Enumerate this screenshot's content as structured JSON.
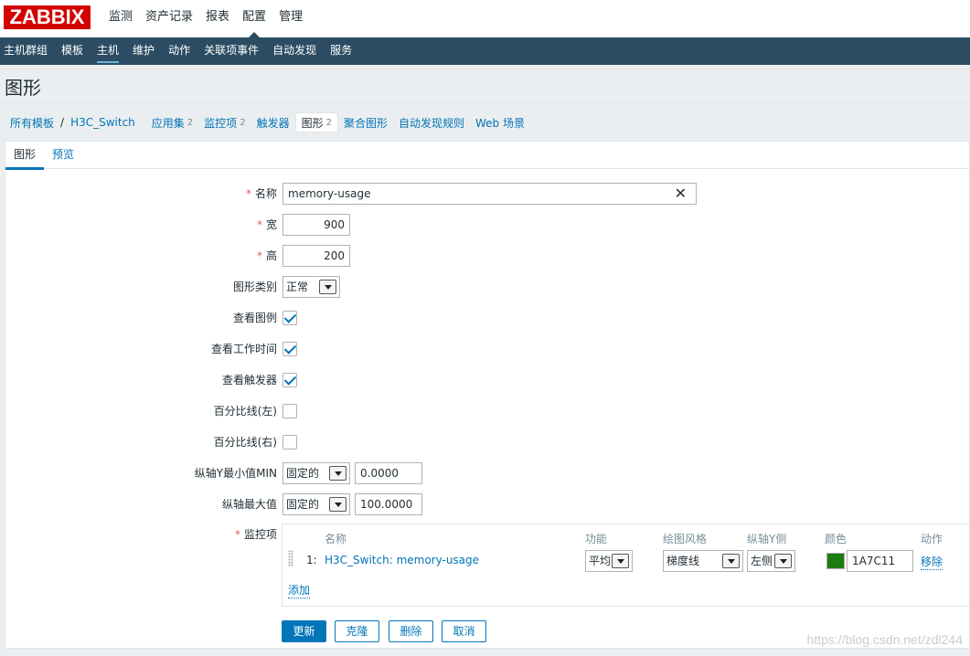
{
  "logo": "ZABBIX",
  "main_nav": [
    "监测",
    "资产记录",
    "报表",
    "配置",
    "管理"
  ],
  "sub_nav": [
    "主机群组",
    "模板",
    "主机",
    "维护",
    "动作",
    "关联项事件",
    "自动发现",
    "服务"
  ],
  "page_title": "图形",
  "breadcrumb": {
    "all_templates": "所有模板",
    "host": "H3C_Switch",
    "items": [
      {
        "label": "应用集",
        "count": "2"
      },
      {
        "label": "监控项",
        "count": "2"
      },
      {
        "label": "触发器",
        "count": ""
      },
      {
        "label": "图形",
        "count": "2"
      },
      {
        "label": "聚合图形",
        "count": ""
      },
      {
        "label": "自动发现规则",
        "count": ""
      },
      {
        "label": "Web 场景",
        "count": ""
      }
    ]
  },
  "tabs": [
    "图形",
    "预览"
  ],
  "form": {
    "name_label": "名称",
    "name_value": "memory-usage",
    "width_label": "宽",
    "width_value": "900",
    "height_label": "高",
    "height_value": "200",
    "graph_type_label": "图形类别",
    "graph_type_value": "正常",
    "show_legend_label": "查看图例",
    "show_legend": true,
    "show_working_time_label": "查看工作时间",
    "show_working_time": true,
    "show_triggers_label": "查看触发器",
    "show_triggers": true,
    "percentile_left_label": "百分比线(左)",
    "percentile_left": false,
    "percentile_right_label": "百分比线(右)",
    "percentile_right": false,
    "ymin_label": "纵轴Y最小值MIN",
    "ymin_type": "固定的",
    "ymin_value": "0.0000",
    "ymax_label": "纵轴最大值",
    "ymax_type": "固定的",
    "ymax_value": "100.0000",
    "items_label": "监控项"
  },
  "items_table": {
    "headers": [
      "名称",
      "功能",
      "绘图风格",
      "纵轴Y侧",
      "颜色",
      "动作"
    ],
    "rows": [
      {
        "index": "1:",
        "name": "H3C_Switch: memory-usage",
        "function": "平均",
        "draw_style": "梯度线",
        "y_side": "左侧",
        "color": "1A7C11",
        "color_hex": "#1a7c11",
        "action": "移除"
      }
    ],
    "add_label": "添加"
  },
  "buttons": {
    "update": "更新",
    "clone": "克隆",
    "delete": "删除",
    "cancel": "取消"
  },
  "watermark": "https://blog.csdn.net/zdl244"
}
